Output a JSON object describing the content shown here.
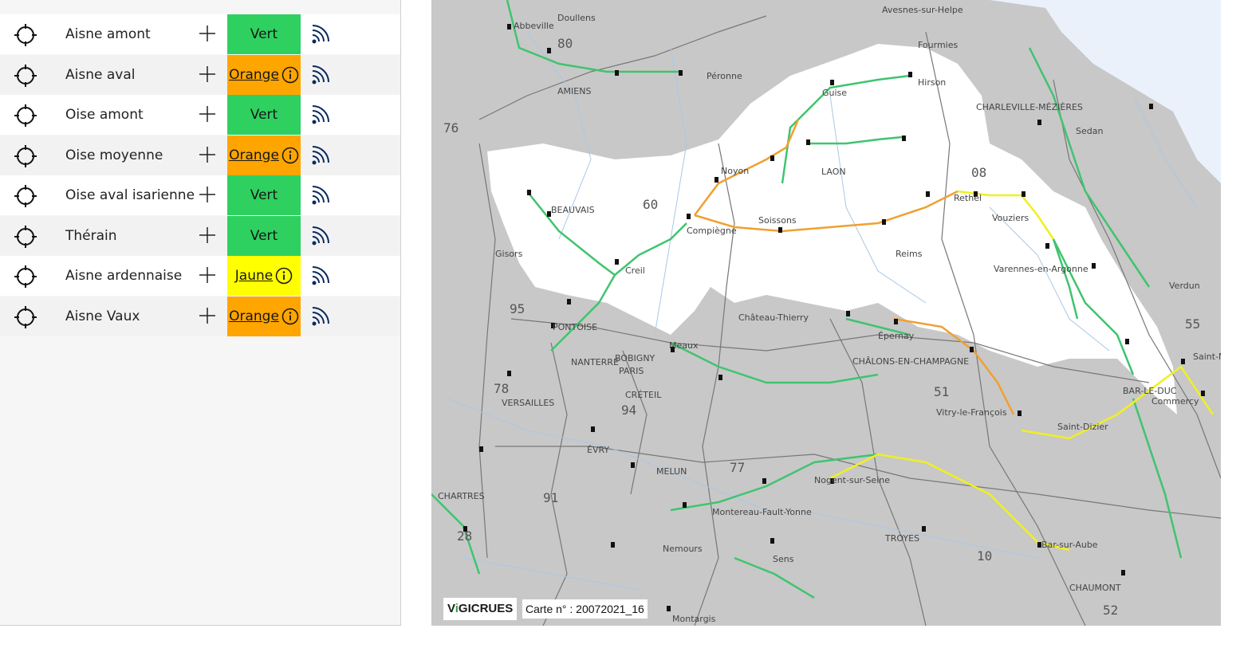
{
  "sections": [
    {
      "name": "Aisne amont",
      "level": "Vert",
      "color": "#2ed160",
      "link": false
    },
    {
      "name": "Aisne aval",
      "level": "Orange",
      "color": "#ffa500",
      "link": true
    },
    {
      "name": "Oise amont",
      "level": "Vert",
      "color": "#2ed160",
      "link": false
    },
    {
      "name": "Oise moyenne",
      "level": "Orange",
      "color": "#ffa500",
      "link": true
    },
    {
      "name": "Oise aval isarienne",
      "level": "Vert",
      "color": "#2ed160",
      "link": false
    },
    {
      "name": "Thérain",
      "level": "Vert",
      "color": "#2ed160",
      "link": false
    },
    {
      "name": "Aisne ardennaise",
      "level": "Jaune",
      "color": "#ffff00",
      "link": true
    },
    {
      "name": "Aisne Vaux",
      "level": "Orange",
      "color": "#ffa500",
      "link": true
    }
  ],
  "icons": {
    "locate": "crosshair-icon",
    "add": "plus-icon",
    "feed": "rss-icon",
    "info": "info-icon"
  },
  "map": {
    "logo_prefix": "V",
    "logo_mark": "i",
    "logo_suffix": "GICRUES",
    "card_number": "Carte n° : 20072021_16",
    "places": [
      "Avesnes-sur-Helpe",
      "Abbeville",
      "Doullens",
      "Fourmies",
      "Hirson",
      "Guise",
      "AMIENS",
      "Péronne",
      "CHARLEVILLE-MÉZIÈRES",
      "Sedan",
      "Noyon",
      "LAON",
      "BEAUVAIS",
      "Rethel",
      "Vouziers",
      "Compiègne",
      "Soissons",
      "Gisors",
      "Creil",
      "Reims",
      "Varennes-en-Argonne",
      "Verdun",
      "PONTOISE",
      "Château-Thierry",
      "Épernay",
      "CHÂLONS-EN-CHAMPAGNE",
      "BOBIGNY",
      "NANTERRE",
      "PARIS",
      "Meaux",
      "VERSAILLES",
      "CRÉTEIL",
      "Vitry-le-François",
      "BAR-LE-DUC",
      "Commercy",
      "Saint-Dizier",
      "ÉVRY",
      "MELUN",
      "CHARTRES",
      "Nogent-sur-Seine",
      "Montereau-Fault-Yonne",
      "TROYES",
      "Nemours",
      "Bar-sur-Aube",
      "Sens",
      "CHAUMONT",
      "Montargis",
      "Saint-M"
    ],
    "departments": [
      "80",
      "76",
      "60",
      "08",
      "95",
      "55",
      "78",
      "94",
      "51",
      "77",
      "91",
      "28",
      "10",
      "52"
    ]
  }
}
